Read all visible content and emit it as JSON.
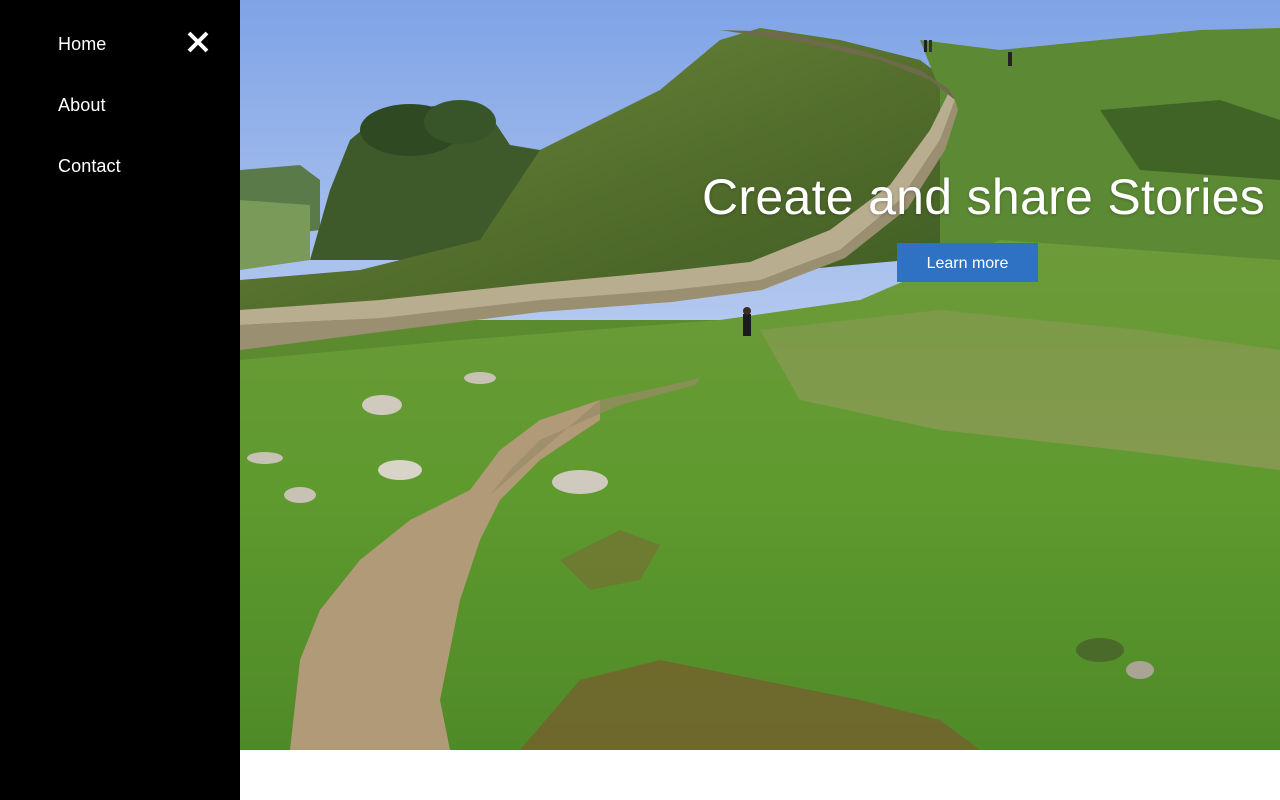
{
  "nav": {
    "items": [
      {
        "label": "Home"
      },
      {
        "label": "About"
      },
      {
        "label": "Contact"
      }
    ],
    "close_icon": "close-icon"
  },
  "hero": {
    "headline": "Create and share Stories",
    "cta_label": "Learn more",
    "image_subject": "grassy hillside with a stone wall and a cobbled footpath under a blue sky"
  },
  "colors": {
    "sidebar_bg": "#000000",
    "cta_bg": "#2f72c4",
    "text": "#ffffff"
  }
}
